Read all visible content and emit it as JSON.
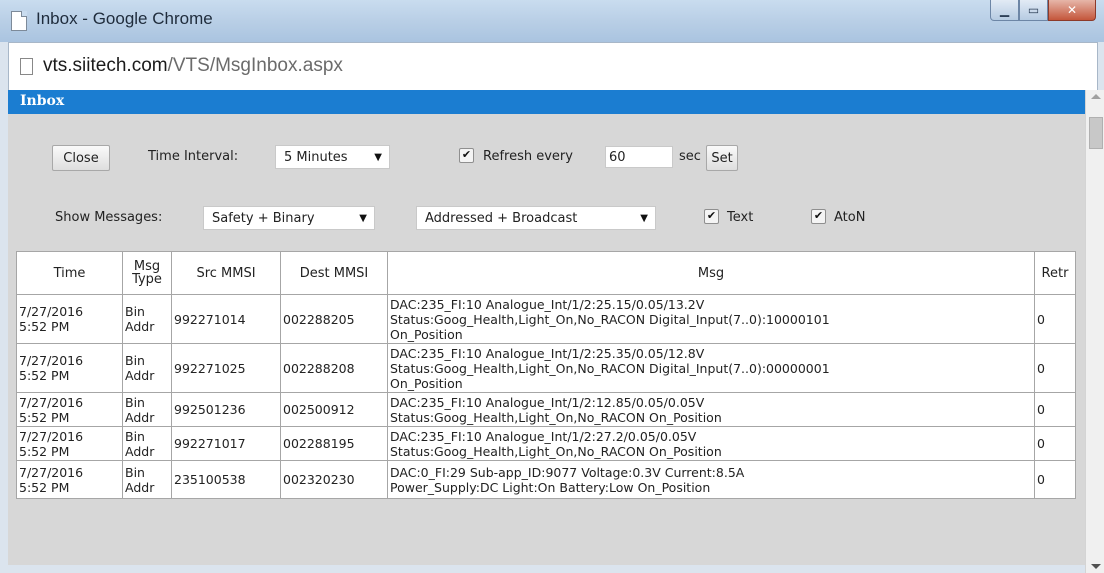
{
  "window": {
    "title": "Inbox - Google Chrome"
  },
  "address": {
    "host": "vts.siitech.com",
    "path": "/VTS/MsgInbox.aspx"
  },
  "panel": {
    "title": "Inbox"
  },
  "controls": {
    "close_label": "Close",
    "time_interval_label": "Time Interval:",
    "time_interval_value": "5 Minutes",
    "refresh_checked": true,
    "refresh_label": "Refresh every",
    "refresh_value": "60",
    "sec_label": "sec",
    "set_label": "Set",
    "show_messages_label": "Show Messages:",
    "show_messages_value": "Safety + Binary",
    "address_filter_value": "Addressed + Broadcast",
    "text_checked": true,
    "text_label": "Text",
    "aton_checked": true,
    "aton_label": "AtoN"
  },
  "table": {
    "headers": {
      "time": "Time",
      "type": "Msg Type",
      "src": "Src MMSI",
      "dest": "Dest MMSI",
      "msg": "Msg",
      "retr": "Retr"
    },
    "rows": [
      {
        "time_date": "7/27/2016",
        "time_clock": "5:52 PM",
        "type_a": "Bin",
        "type_b": "Addr",
        "src": "992271014",
        "dest": "002288205",
        "msg_lines": [
          "DAC:235_FI:10 Analogue_Int/1/2:25.15/0.05/13.2V",
          "Status:Goog_Health,Light_On,No_RACON Digital_Input(7..0):10000101",
          "On_Position"
        ],
        "retr": "0"
      },
      {
        "time_date": "7/27/2016",
        "time_clock": "5:52 PM",
        "type_a": "Bin",
        "type_b": "Addr",
        "src": "992271025",
        "dest": "002288208",
        "msg_lines": [
          "DAC:235_FI:10 Analogue_Int/1/2:25.35/0.05/12.8V",
          "Status:Goog_Health,Light_On,No_RACON Digital_Input(7..0):00000001",
          "On_Position"
        ],
        "retr": "0"
      },
      {
        "time_date": "7/27/2016",
        "time_clock": "5:52 PM",
        "type_a": "Bin",
        "type_b": "Addr",
        "src": "992501236",
        "dest": "002500912",
        "msg_lines": [
          "DAC:235_FI:10 Analogue_Int/1/2:12.85/0.05/0.05V",
          "Status:Goog_Health,Light_On,No_RACON On_Position"
        ],
        "retr": "0"
      },
      {
        "time_date": "7/27/2016",
        "time_clock": "5:52 PM",
        "type_a": "Bin",
        "type_b": "Addr",
        "src": "992271017",
        "dest": "002288195",
        "msg_lines": [
          "DAC:235_FI:10 Analogue_Int/1/2:27.2/0.05/0.05V",
          "Status:Goog_Health,Light_On,No_RACON On_Position"
        ],
        "retr": "0"
      },
      {
        "time_date": "7/27/2016",
        "time_clock": "5:52 PM",
        "type_a": "Bin",
        "type_b": "Addr",
        "src": "235100538",
        "dest": "002320230",
        "msg_lines": [
          "DAC:0_FI:29 Sub-app_ID:9077 Voltage:0.3V Current:8.5A",
          "Power_Supply:DC Light:On Battery:Low On_Position"
        ],
        "retr": "0"
      }
    ]
  },
  "colors": {
    "header_bar": "#1b7dd1",
    "panel_bg": "#d7d7d7"
  },
  "icons": {
    "page": "page-icon",
    "doc": "doc-icon",
    "minimize": "minimize-icon",
    "maximize": "maximize-icon",
    "close": "close-icon",
    "check": "check-icon"
  }
}
